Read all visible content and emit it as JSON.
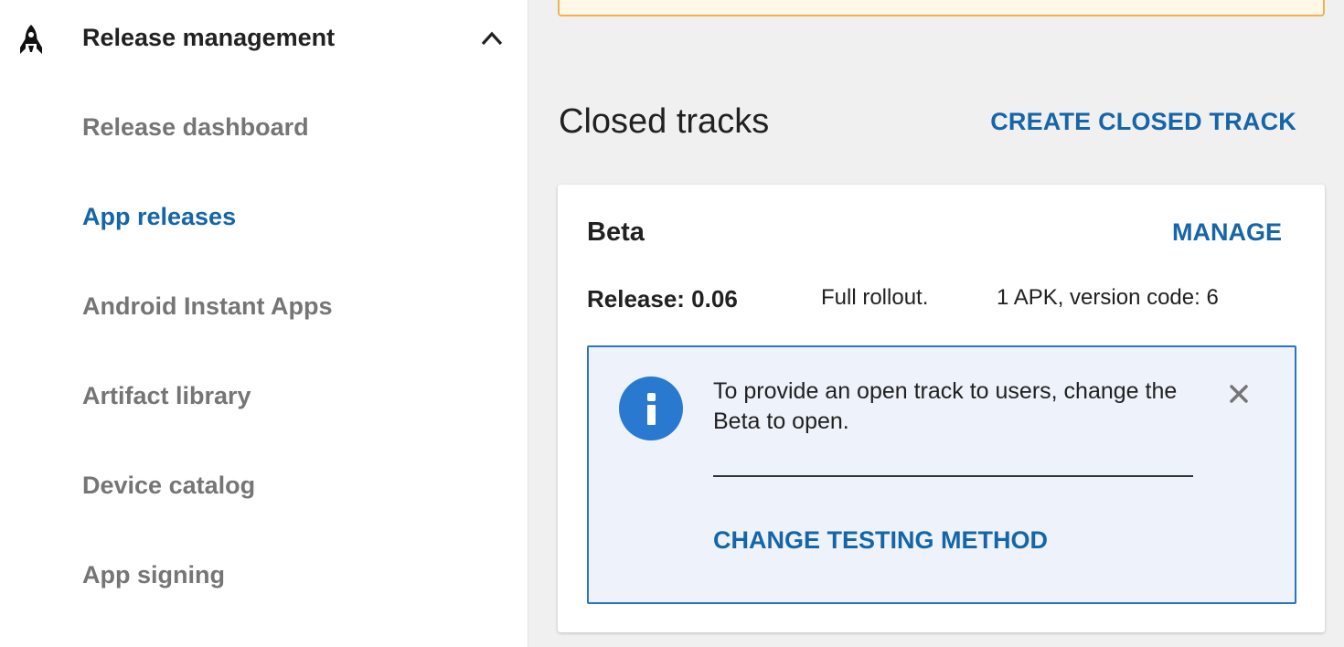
{
  "sidebar": {
    "header": {
      "label": "Release management",
      "icon": "rocket-icon",
      "toggle_icon": "chevron-up-icon"
    },
    "items": [
      {
        "label": "Release dashboard",
        "active": false
      },
      {
        "label": "App releases",
        "active": true
      },
      {
        "label": "Android Instant Apps",
        "active": false
      },
      {
        "label": "Artifact library",
        "active": false
      },
      {
        "label": "Device catalog",
        "active": false
      },
      {
        "label": "App signing",
        "active": false
      }
    ]
  },
  "main": {
    "section_title": "Closed tracks",
    "create_button": "CREATE CLOSED TRACK",
    "card": {
      "title": "Beta",
      "manage_button": "MANAGE",
      "release": "Release: 0.06",
      "rollout": "Full rollout.",
      "apk_info": "1 APK, version code: 6",
      "info": {
        "icon": "info-icon",
        "message": "To provide an open track to users, change the Beta to open.",
        "action": "CHANGE TESTING METHOD"
      }
    }
  },
  "colors": {
    "accent": "#1565a8",
    "info_border": "#2a73c6",
    "info_bg": "#eef3fb",
    "warning_border": "#f0b24d",
    "muted_text": "#757575"
  }
}
